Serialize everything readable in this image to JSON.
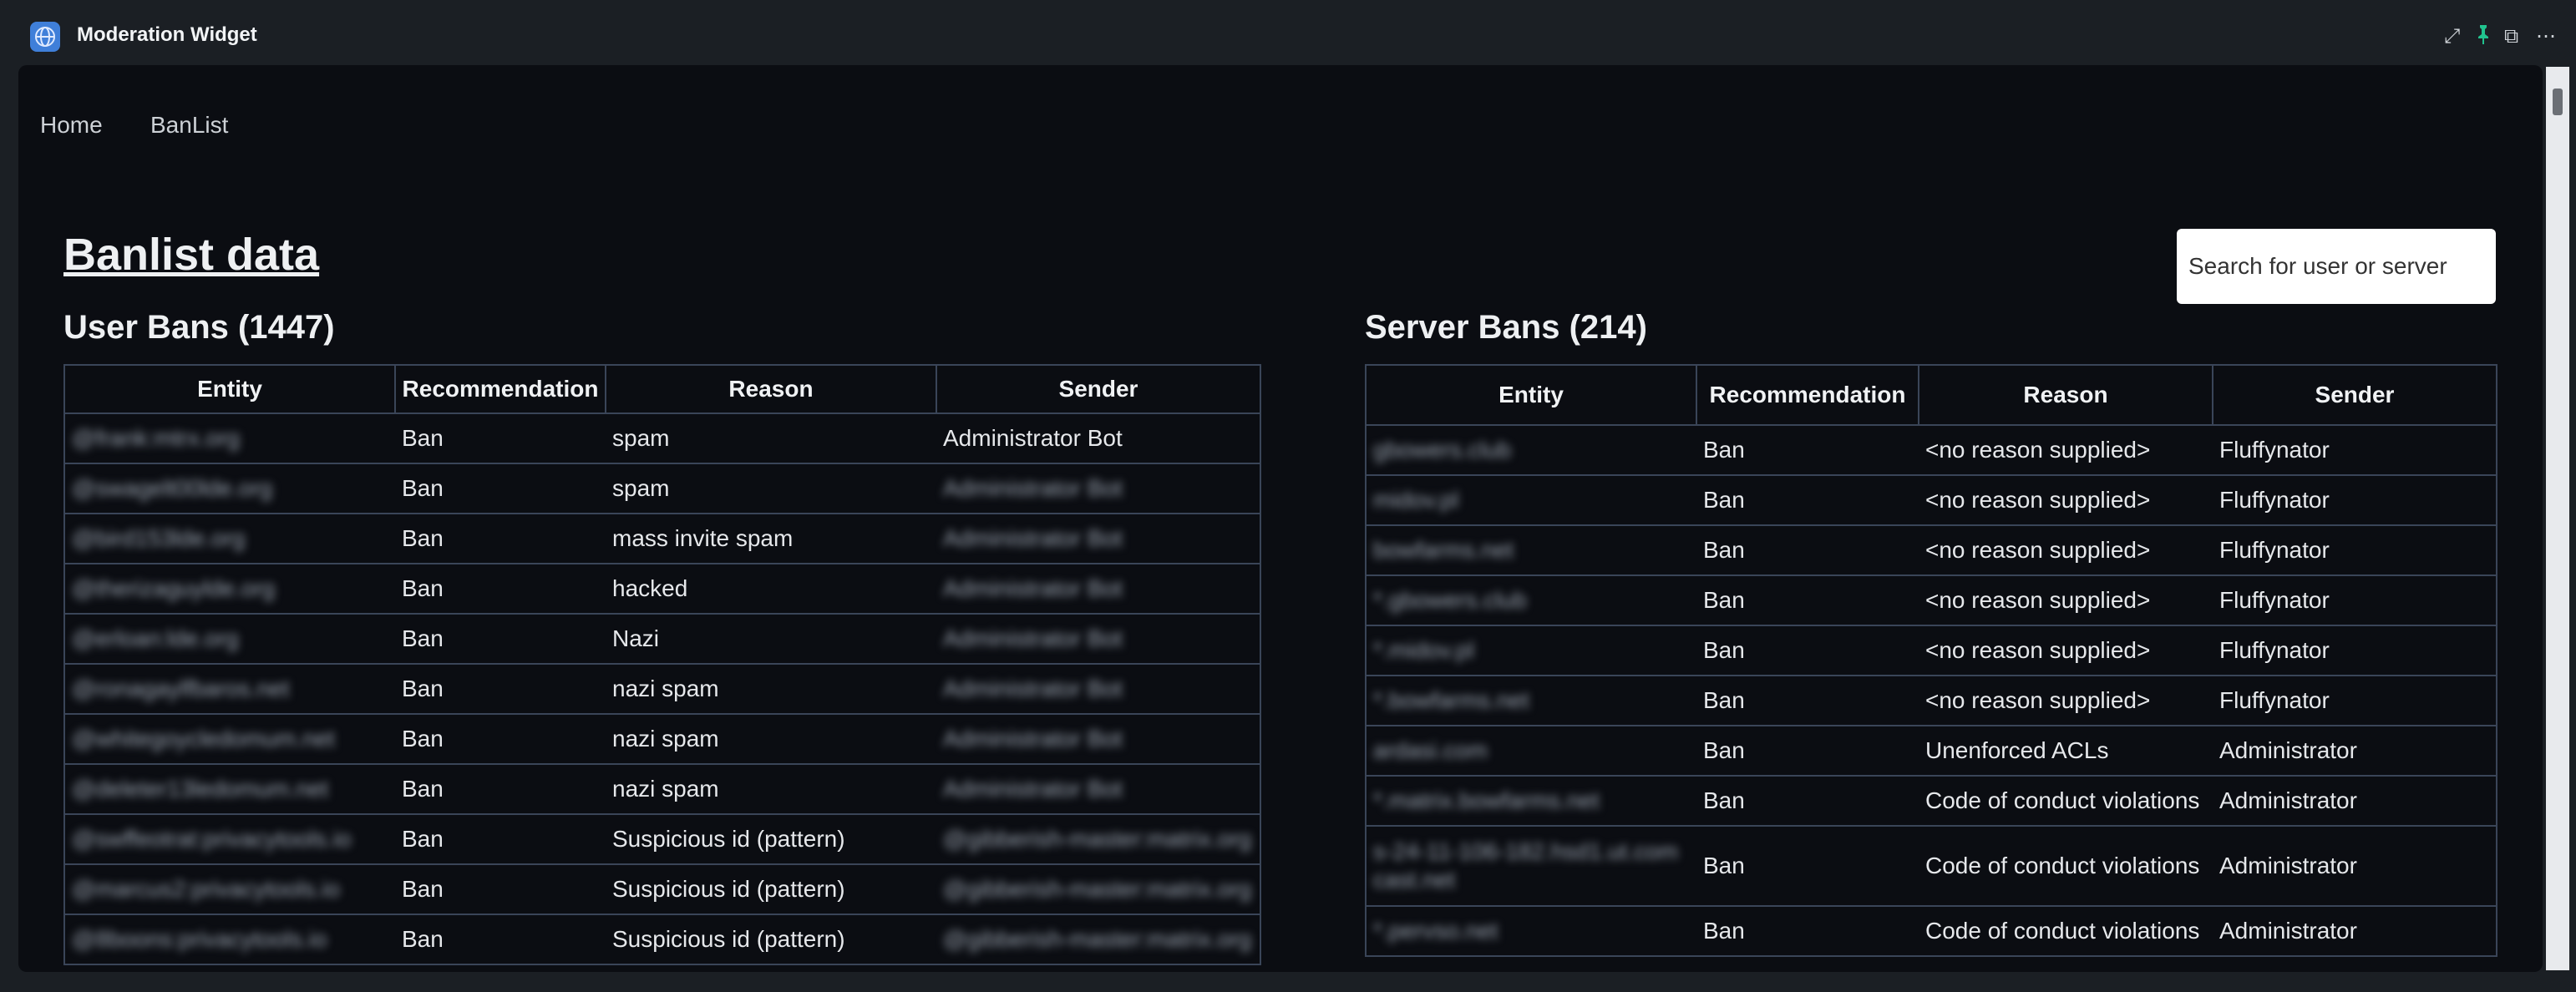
{
  "window": {
    "title": "Moderation Widget",
    "controls": [
      {
        "name": "maximize-icon",
        "glyph": "⤢"
      },
      {
        "name": "pin-icon",
        "glyph": "📌"
      },
      {
        "name": "popout-icon",
        "glyph": "⧉"
      },
      {
        "name": "more-options-icon",
        "glyph": "⋯"
      }
    ],
    "accent": "#3f7fd9",
    "pin_color": "#21c28e"
  },
  "nav": {
    "home_label": "Home",
    "banlist_label": "BanList"
  },
  "page": {
    "title": "Banlist data"
  },
  "search": {
    "placeholder": "Search for user or server",
    "value": ""
  },
  "user_bans": {
    "title": "User Bans (1447)",
    "columns": [
      "Entity",
      "Recommendation",
      "Reason",
      "Sender"
    ],
    "rows": [
      {
        "entity": "@frank:mtrx.org",
        "recommendation": "Ban",
        "reason": "spam",
        "sender": "Administrator Bot",
        "sender_blurred": false
      },
      {
        "entity": "@swagelt00lde.org",
        "recommendation": "Ban",
        "reason": "spam",
        "sender": "Administrator Bot",
        "sender_blurred": true
      },
      {
        "entity": "@bird153lde.org",
        "recommendation": "Ban",
        "reason": "mass invite spam",
        "sender": "Administrator Bot",
        "sender_blurred": true
      },
      {
        "entity": "@therizaguylde.org",
        "recommendation": "Ban",
        "reason": "hacked",
        "sender": "Administrator Bot",
        "sender_blurred": true
      },
      {
        "entity": "@erloan:lde.org",
        "recommendation": "Ban",
        "reason": "Nazi",
        "sender": "Administrator Bot",
        "sender_blurred": true
      },
      {
        "entity": "@ronagaylfbaros.net",
        "recommendation": "Ban",
        "reason": "nazi spam",
        "sender": "Administrator Bot",
        "sender_blurred": true
      },
      {
        "entity": "@whitegoycledomum.net",
        "recommendation": "Ban",
        "reason": "nazi spam",
        "sender": "Administrator Bot",
        "sender_blurred": true
      },
      {
        "entity": "@deleter13ledomum.net",
        "recommendation": "Ban",
        "reason": "nazi spam",
        "sender": "Administrator Bot",
        "sender_blurred": true
      },
      {
        "entity": "@swffeotrat:privacytools.io",
        "recommendation": "Ban",
        "reason": "Suspicious id (pattern)",
        "sender": "@gibberish-master:matrix.org",
        "sender_blurred": true
      },
      {
        "entity": "@marcus2:privacytools.io",
        "recommendation": "Ban",
        "reason": "Suspicious id (pattern)",
        "sender": "@gibberish-master:matrix.org",
        "sender_blurred": true
      },
      {
        "entity": "@8boons:privacytools.io",
        "recommendation": "Ban",
        "reason": "Suspicious id (pattern)",
        "sender": "@gibberish-master:matrix.org",
        "sender_blurred": true
      }
    ]
  },
  "server_bans": {
    "title": "Server Bans (214)",
    "columns": [
      "Entity",
      "Recommendation",
      "Reason",
      "Sender"
    ],
    "rows": [
      {
        "entity": "gbowers.club",
        "recommendation": "Ban",
        "reason": "<no reason supplied>",
        "sender": "Fluffynator"
      },
      {
        "entity": "midov.pl",
        "recommendation": "Ban",
        "reason": "<no reason supplied>",
        "sender": "Fluffynator"
      },
      {
        "entity": "bowfarms.net",
        "recommendation": "Ban",
        "reason": "<no reason supplied>",
        "sender": "Fluffynator"
      },
      {
        "entity": "*.gbowers.club",
        "recommendation": "Ban",
        "reason": "<no reason supplied>",
        "sender": "Fluffynator"
      },
      {
        "entity": "*.midov.pl",
        "recommendation": "Ban",
        "reason": "<no reason supplied>",
        "sender": "Fluffynator"
      },
      {
        "entity": "*.bowfarms.net",
        "recommendation": "Ban",
        "reason": "<no reason supplied>",
        "sender": "Fluffynator"
      },
      {
        "entity": "ardasi.com",
        "recommendation": "Ban",
        "reason": "Unenforced ACLs",
        "sender": "Administrator"
      },
      {
        "entity": "*.matrix.bowfarms.net",
        "recommendation": "Ban",
        "reason": "Code of conduct violations",
        "sender": "Administrator"
      },
      {
        "entity": "s-24-11-106-182.hsd1.ut.com cast.net",
        "recommendation": "Ban",
        "reason": "Code of conduct violations",
        "sender": "Administrator"
      },
      {
        "entity": "*.pervso.net",
        "recommendation": "Ban",
        "reason": "Code of conduct violations",
        "sender": "Administrator"
      }
    ]
  }
}
